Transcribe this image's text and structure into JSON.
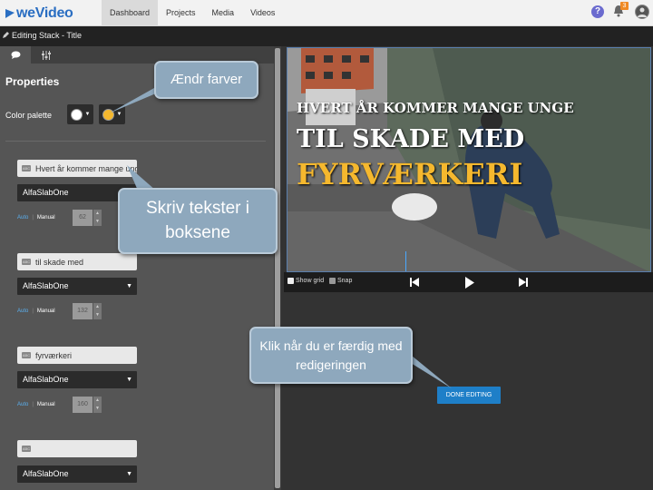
{
  "app": {
    "logo_text": "weVideo",
    "nav": [
      "Dashboard",
      "Projects",
      "Media",
      "Videos"
    ],
    "notification_count": "3"
  },
  "stack": {
    "title": "Editing Stack - Title"
  },
  "properties": {
    "title": "Properties",
    "palette_label": "Color palette",
    "palette_colors": [
      "#ffffff",
      "#f5b82e"
    ]
  },
  "text_items": [
    {
      "text": "Hvert år kommer mange ung",
      "font": "AlfaSlabOne",
      "auto": "Auto",
      "manual": "Manual",
      "size": "62"
    },
    {
      "text": "til skade med",
      "font": "AlfaSlabOne",
      "auto": "Auto",
      "manual": "Manual",
      "size": "132"
    },
    {
      "text": "fyrværkeri",
      "font": "AlfaSlabOne",
      "auto": "Auto",
      "manual": "Manual",
      "size": "160"
    },
    {
      "text": "",
      "font": "AlfaSlabOne"
    }
  ],
  "video": {
    "line1": "HVERT ÅR KOMMER MANGE UNGE",
    "line2": "TIL SKADE MED",
    "line3": "FYRVÆRKERI"
  },
  "controls": {
    "show_grid": "Show grid",
    "snap": "Snap"
  },
  "done_label": "DONE EDITING",
  "callouts": {
    "colors": "Ændr farver",
    "texts": "Skriv tekster i boksene",
    "done": "Klik når du er færdig med redigeringen"
  }
}
